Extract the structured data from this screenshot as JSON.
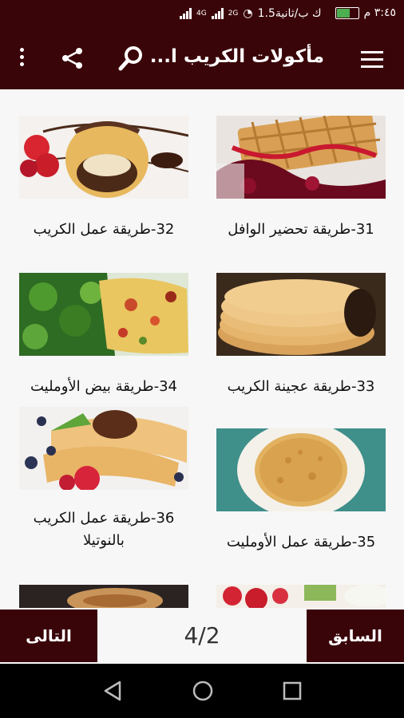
{
  "status_bar": {
    "time": "٣:٤٥ م",
    "speed": "1.5ك ب/ثانية",
    "network_4g": "4G",
    "network_2g": "2G",
    "battery_level": 0.6
  },
  "app_bar": {
    "title": "مأكولات الكريب ا...",
    "icons": [
      "menu-icon",
      "search-icon",
      "share-icon",
      "more-vert-icon"
    ]
  },
  "recipes": [
    {
      "caption": "31-طريقة تحضير الوافل",
      "image": "waffles-with-berry-sauce"
    },
    {
      "caption": "32-طريقة عمل الكريب",
      "image": "crepe-roll-with-chocolate-and-strawberries"
    },
    {
      "caption": "33-طريقة عجينة الكريب",
      "image": "stack-of-crepes"
    },
    {
      "caption": "34-طريقة بيض الأومليت",
      "image": "scrambled-eggs-with-salad"
    },
    {
      "caption": "35-طريقة عمل الأومليت",
      "image": "omelette-on-plate"
    },
    {
      "caption": "36-طريقة عمل الكريب بالنوتيلا",
      "image": "nutella-crepes-with-berries"
    },
    {
      "caption": "",
      "image": "partial-image-strawberries"
    },
    {
      "caption": "",
      "image": "partial-image-crepe"
    }
  ],
  "footer": {
    "previous_label": "السابق",
    "next_label": "التالى",
    "page_indicator": "4/2"
  },
  "nav_bar": {
    "icons": [
      "back-icon",
      "home-icon",
      "recents-icon"
    ]
  },
  "colors": {
    "primary": "#3a0509",
    "background": "#f7f7f7"
  }
}
